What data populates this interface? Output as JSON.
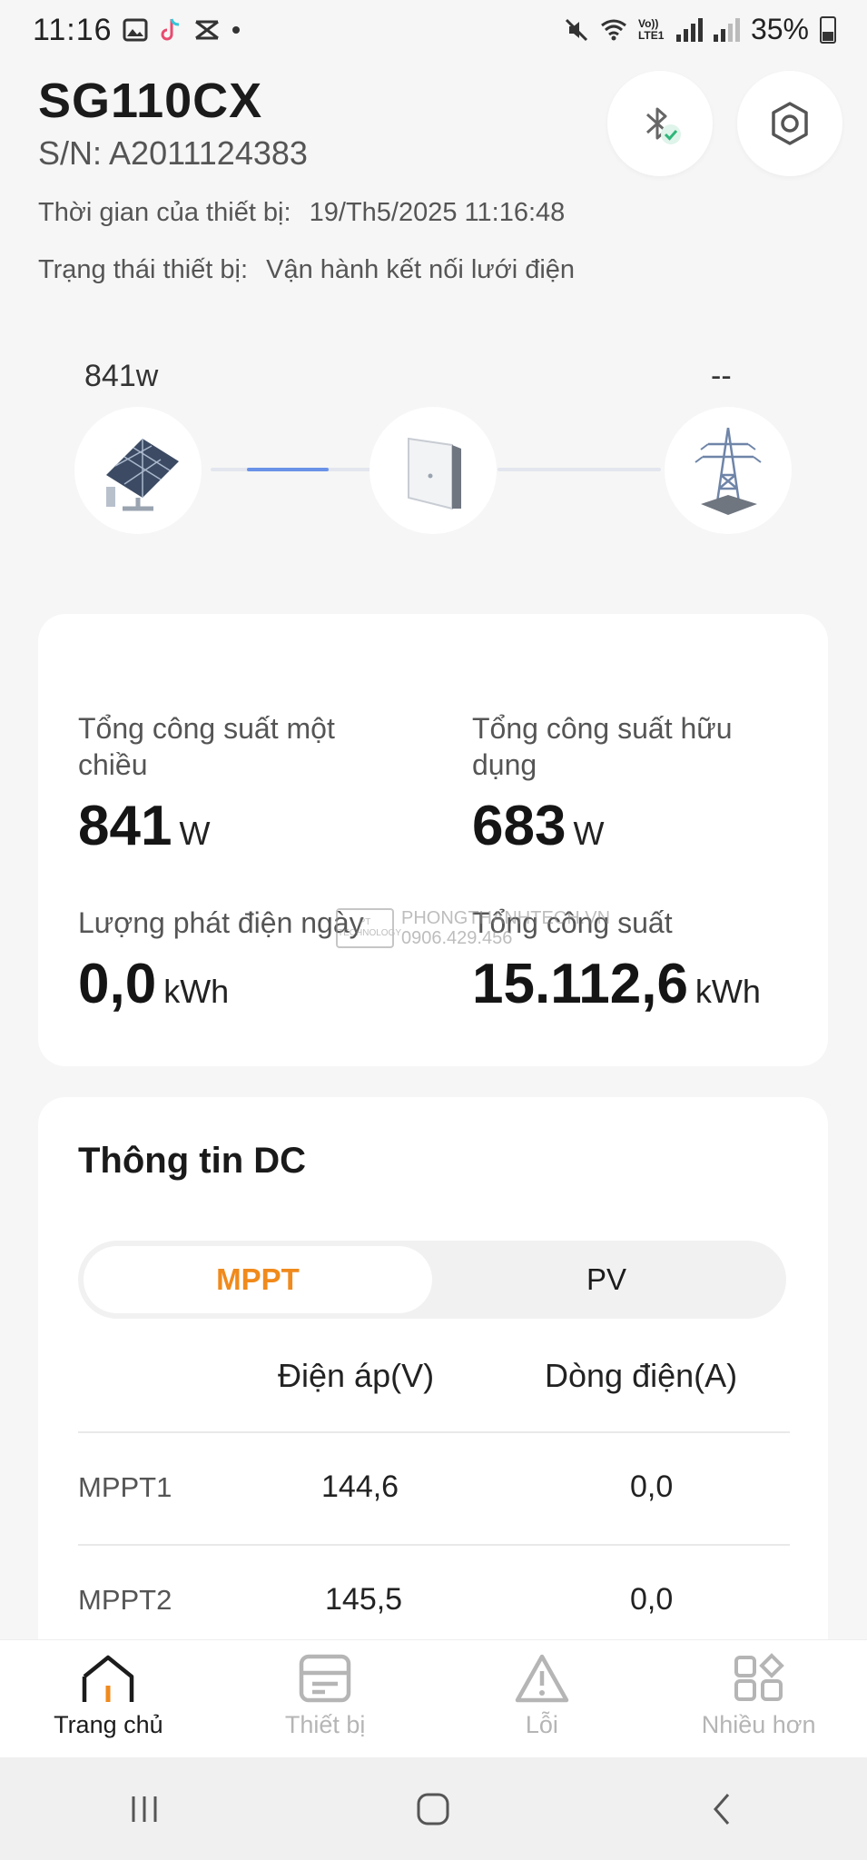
{
  "status_bar": {
    "time": "11:16",
    "battery": "35%",
    "network": "Vo)) LTE1",
    "icons": [
      "gallery-icon",
      "tiktok-icon",
      "capcut-icon",
      "dot-icon",
      "mute-icon",
      "wifi-icon",
      "signal-icon",
      "battery-icon"
    ]
  },
  "header": {
    "device_name": "SG110CX",
    "serial": "S/N: A2011124383",
    "time_label": "Thời gian của thiết bị:",
    "time_value": "19/Th5/2025 11:16:48",
    "status_label": "Trạng thái thiết bị:",
    "status_value": "Vận hành kết nối lưới điện",
    "buttons": [
      "bluetooth-connected-icon",
      "settings-icon"
    ]
  },
  "flow": {
    "pv_power": "841w",
    "grid_power": "--",
    "nodes": [
      "solar-panel-icon",
      "inverter-icon",
      "grid-tower-icon"
    ]
  },
  "stats": {
    "dc_power_label": "Tổng công suất một chiều",
    "dc_power_value": "841",
    "dc_power_unit": "W",
    "active_power_label": "Tổng công suất hữu dụng",
    "active_power_value": "683",
    "active_power_unit": "W",
    "daily_yield_label": "Lượng phát điện ngày",
    "daily_yield_value": "0,0",
    "daily_yield_unit": "kWh",
    "total_yield_label": "Tổng công suất",
    "total_yield_value": "15.112,6",
    "total_yield_unit": "kWh"
  },
  "watermark": {
    "brand": "PHONGTHANHTECH.VN",
    "phone": "0906.429.456",
    "logo_text": "PT TECHNOLOGY"
  },
  "dc_info": {
    "title": "Thông tin DC",
    "tabs": [
      "MPPT",
      "PV"
    ],
    "active_tab": "MPPT",
    "columns": [
      "Điện áp(V)",
      "Dòng điện(A)"
    ],
    "rows": [
      {
        "name": "MPPT1",
        "voltage": "144,6",
        "current": "0,0"
      },
      {
        "name": "MPPT2",
        "voltage": "145,5",
        "current": "0,0"
      }
    ]
  },
  "bottom_nav": {
    "items": [
      {
        "label": "Trang chủ",
        "icon": "home-icon",
        "active": true
      },
      {
        "label": "Thiết bị",
        "icon": "device-icon",
        "active": false
      },
      {
        "label": "Lỗi",
        "icon": "warning-icon",
        "active": false
      },
      {
        "label": "Nhiều hơn",
        "icon": "more-apps-icon",
        "active": false
      }
    ]
  },
  "colors": {
    "accent": "#f08a1c",
    "flow_active": "#4a7de6",
    "background": "#f6f6f6"
  }
}
